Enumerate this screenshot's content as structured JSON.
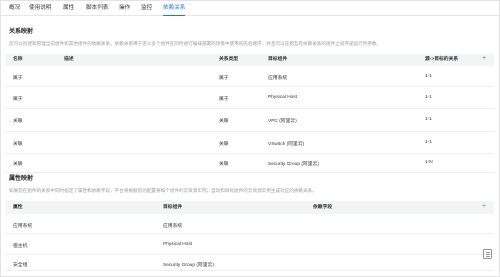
{
  "tabs": [
    "概况",
    "使用说明",
    "属性",
    "脚本列表",
    "操作",
    "监控",
    "依赖关系"
  ],
  "relation_section": {
    "title": "关系映射",
    "description": "您可以创建和管理当前组件和其他组件的依赖关系，依赖关系用于定义多个组件在同时进行编排部署的场景中使用的先后顺序，并且可以在相互有依赖关系的组件之间传递运行时参数。",
    "columns": [
      "名称",
      "描述",
      "关系类型",
      "目标组件",
      "源->目标的关系"
    ],
    "add_icon": "plus-icon",
    "rows": [
      {
        "name": "属于",
        "desc": "",
        "type": "属于",
        "target": "应用系统",
        "cardinality": "1-1"
      },
      {
        "name": "属于",
        "desc": "",
        "type": "属于",
        "target": "Physical Host",
        "cardinality": "1-1"
      },
      {
        "name": "关联",
        "desc": "",
        "type": "关联",
        "target": "VPC (阿里云)",
        "cardinality": "1-1"
      },
      {
        "name": "关联",
        "desc": "",
        "type": "关联",
        "target": "VSwitch (阿里云)",
        "cardinality": "1-1"
      },
      {
        "name": "关联",
        "desc": "",
        "type": "关联",
        "target": "Security Group (阿里云)",
        "cardinality": "1-N"
      }
    ]
  },
  "attribute_section": {
    "title": "属性映射",
    "description": "如果您在组件的关系中同时指定了属性和依赖字段，平台将根据您的配置将每个组件的云资源实例，自动和目标组件的云资源实例生成对应的依赖关系。",
    "columns": [
      "属性",
      "目标组件",
      "依赖字段"
    ],
    "add_icon": "plus-icon",
    "rows": [
      {
        "attr": "应用系统",
        "target": "应用系统",
        "field": ""
      },
      {
        "attr": "宿主机",
        "target": "Physical Host",
        "field": ""
      },
      {
        "attr": "安全组",
        "target": "Security Group (阿里云)",
        "field": ""
      }
    ]
  },
  "floating_button_icon": "document-list-icon"
}
